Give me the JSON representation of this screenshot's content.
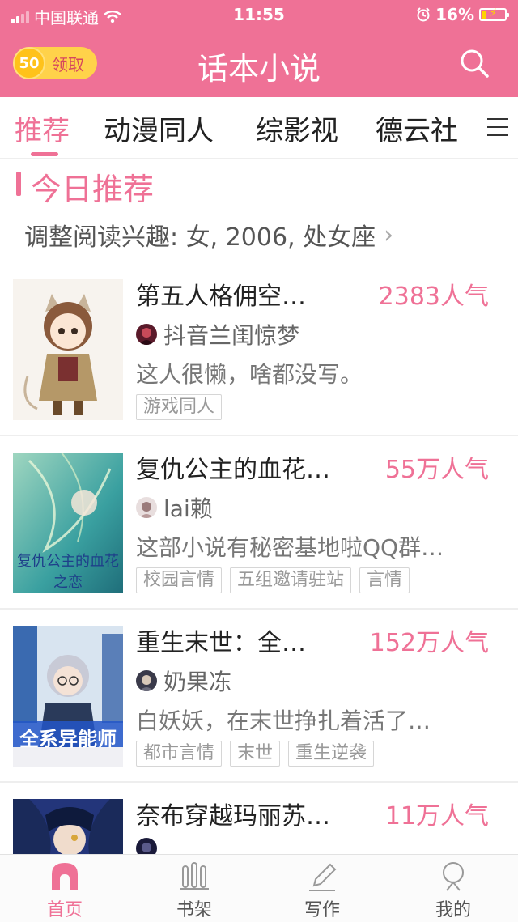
{
  "status_bar": {
    "carrier": "中国联通",
    "time": "11:55",
    "battery": "16%"
  },
  "header": {
    "coin_value": "50",
    "coin_label": "领取",
    "title": "话本小说"
  },
  "tabs": [
    {
      "label": "推荐",
      "active": true
    },
    {
      "label": "动漫同人",
      "active": false
    },
    {
      "label": "综影视",
      "active": false
    },
    {
      "label": "德云社",
      "active": false
    }
  ],
  "section": {
    "title": "今日推荐",
    "interest": "调整阅读兴趣: 女, 2006, 处女座"
  },
  "books": [
    {
      "title": "第五人格佣空…",
      "popularity": "2383人气",
      "author": "抖音兰闺惊梦",
      "desc": "这人很懒，啥都没写。",
      "tags": [
        "游戏同人"
      ]
    },
    {
      "title": "复仇公主的血花…",
      "popularity": "55万人气",
      "author": "lai赖",
      "desc": "这部小说有秘密基地啦QQ群…",
      "tags": [
        "校园言情",
        "五组邀请驻站",
        "言情"
      ],
      "cover_text": "复仇公主的血花之恋"
    },
    {
      "title": "重生末世：全…",
      "popularity": "152万人气",
      "author": "奶果冻",
      "desc": "白妖妖，在末世挣扎着活了…",
      "tags": [
        "都市言情",
        "末世",
        "重生逆袭"
      ],
      "cover_text": "全系异能师"
    },
    {
      "title": "奈布穿越玛丽苏…",
      "popularity": "11万人气",
      "author": "",
      "desc": "",
      "tags": []
    }
  ],
  "bottom_nav": [
    {
      "label": "首页",
      "icon": "home-icon",
      "active": true
    },
    {
      "label": "书架",
      "icon": "bookshelf-icon",
      "active": false
    },
    {
      "label": "写作",
      "icon": "pen-icon",
      "active": false
    },
    {
      "label": "我的",
      "icon": "profile-icon",
      "active": false
    }
  ],
  "colors": {
    "brand": "#ef7196",
    "coin": "#ffd24a"
  }
}
